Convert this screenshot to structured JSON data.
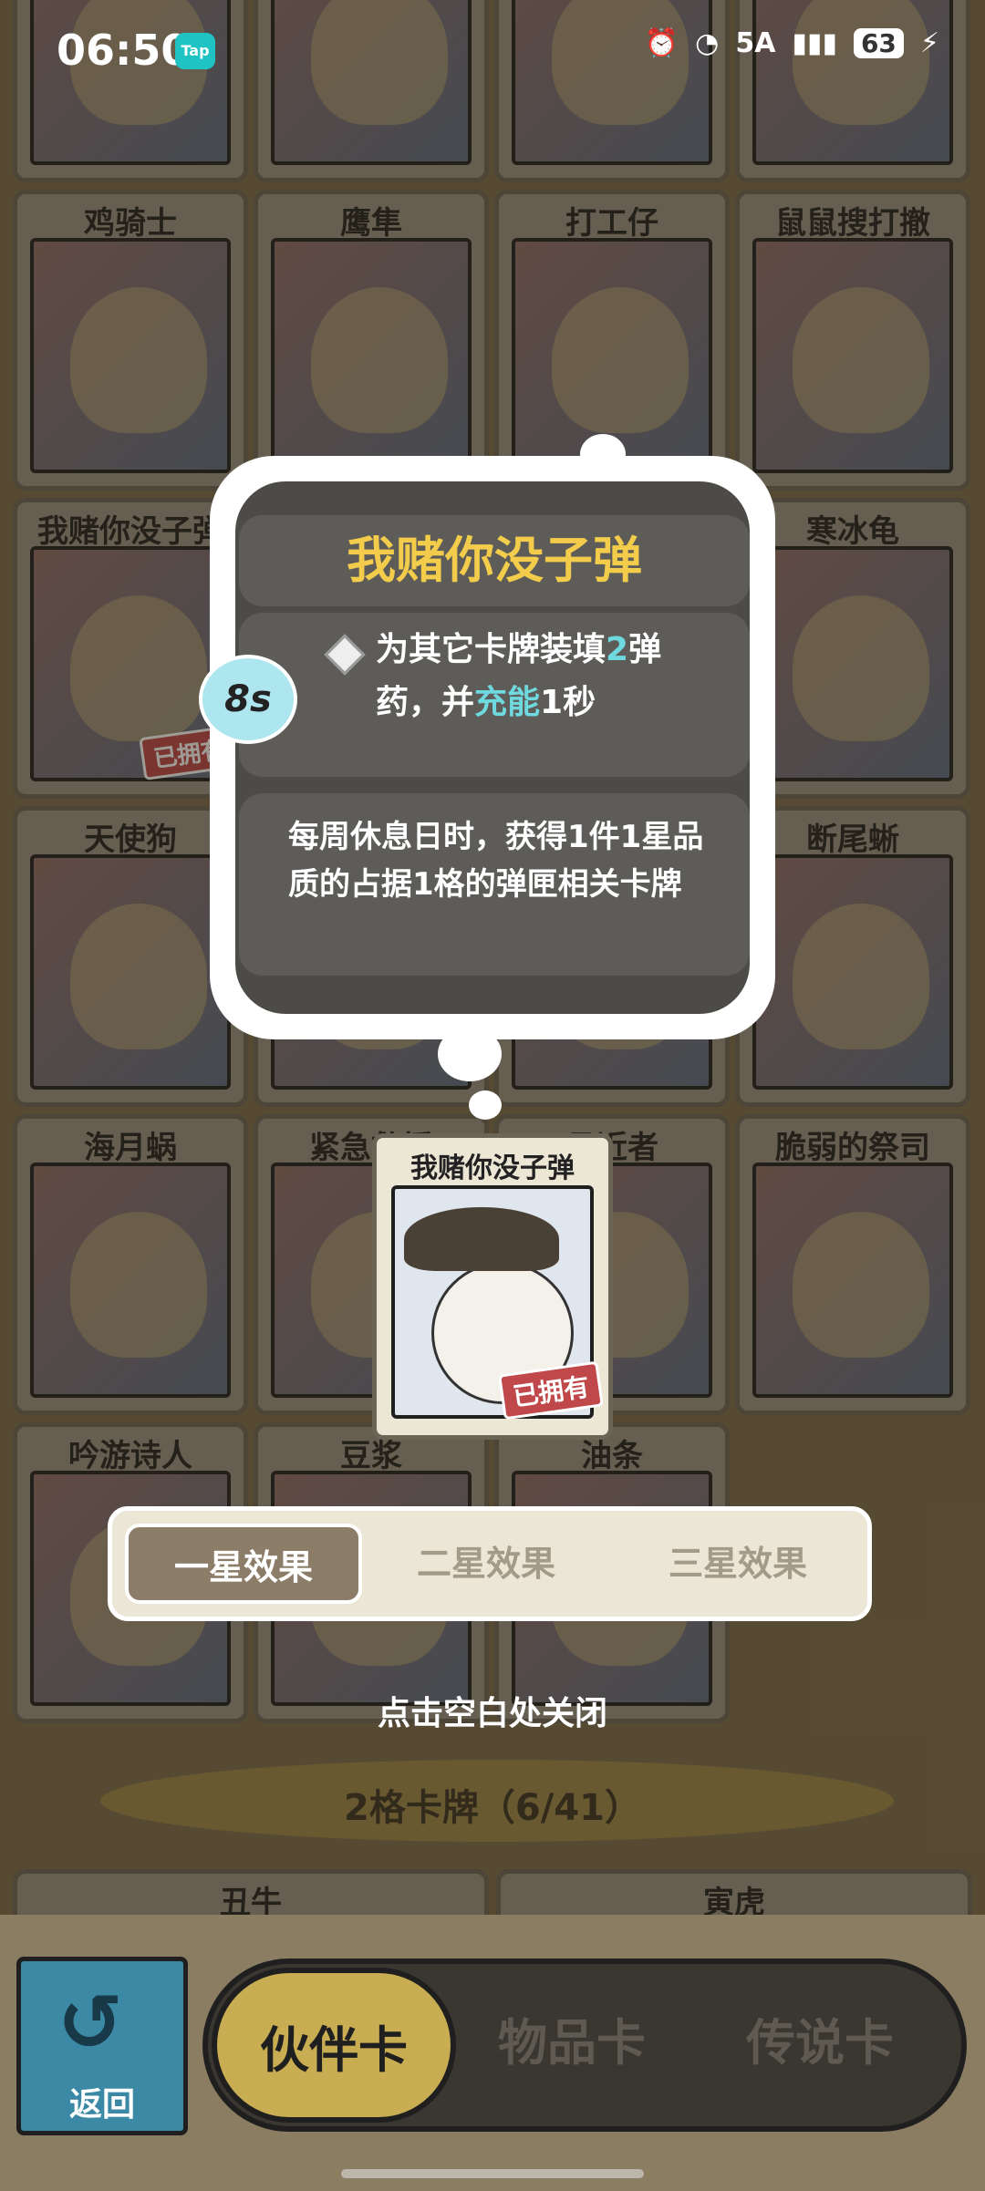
{
  "status_bar": {
    "time": "06:50",
    "tap_badge": "Tap",
    "network": "5A",
    "battery": "63"
  },
  "cards": [
    {
      "name": "",
      "owned": false
    },
    {
      "name": "",
      "owned": false
    },
    {
      "name": "",
      "owned": false
    },
    {
      "name": "",
      "owned": false
    },
    {
      "name": "鸡骑士",
      "owned": false
    },
    {
      "name": "鹰隼",
      "owned": false
    },
    {
      "name": "打工仔",
      "owned": false
    },
    {
      "name": "鼠鼠搜打撤",
      "owned": false
    },
    {
      "name": "我赌你没子弹",
      "owned": true
    },
    {
      "name": "",
      "owned": false
    },
    {
      "name": "",
      "owned": false
    },
    {
      "name": "寒冰龟",
      "owned": false
    },
    {
      "name": "天使狗",
      "owned": false
    },
    {
      "name": "",
      "owned": false
    },
    {
      "name": "",
      "owned": false
    },
    {
      "name": "断尾蜥",
      "owned": false
    },
    {
      "name": "海月蜗",
      "owned": false
    },
    {
      "name": "紧急救援",
      "owned": false
    },
    {
      "name": "悬近者",
      "owned": false
    },
    {
      "name": "脆弱的祭司",
      "owned": false
    },
    {
      "name": "吟游诗人",
      "owned": false
    },
    {
      "name": "豆浆",
      "owned": false
    },
    {
      "name": "油条",
      "owned": false
    }
  ],
  "owned_label": "已拥有",
  "tooltip": {
    "title": "我赌你没子弹",
    "cooldown": "8s",
    "effect_prefix": "为其它卡牌装填",
    "effect_num1": "2",
    "effect_mid": "弹药，并",
    "effect_hl": "充能",
    "effect_suffix": "1秒",
    "description": "每周休息日时，获得1件1星品质的占据1格的弹匣相关卡牌"
  },
  "selected_card": {
    "name": "我赌你没子弹",
    "owned_label": "已拥有"
  },
  "star_tabs": [
    "一星效果",
    "二星效果",
    "三星效果"
  ],
  "close_hint": "点击空白处关闭",
  "section": {
    "title": "2格卡牌（6/41）"
  },
  "section_cards": [
    "丑牛",
    "寅虎"
  ],
  "back_button": "返回",
  "nav_tabs": [
    "伙伴卡",
    "物品卡",
    "传说卡"
  ]
}
